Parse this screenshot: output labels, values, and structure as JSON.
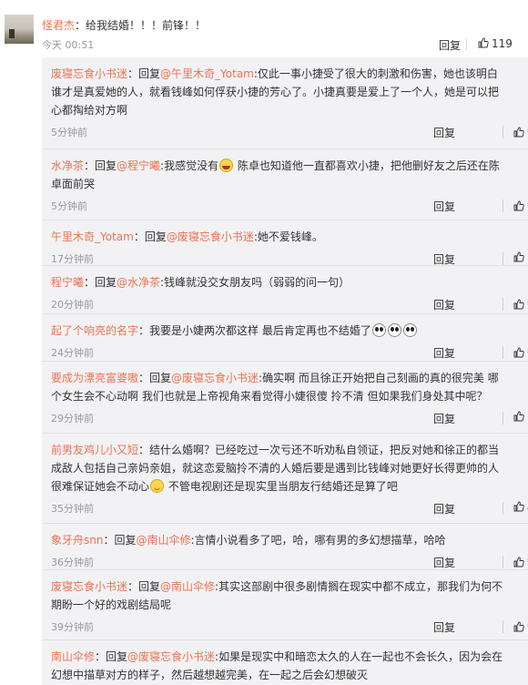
{
  "main_comment": {
    "user": "怪君杰",
    "text": "：给我结婚！！！前锋！！",
    "time": "今天 00:51",
    "reply_label": "回复",
    "likes": "119"
  },
  "replies": [
    {
      "parts": [
        {
          "t": "u",
          "v": "废寝忘食小书迷"
        },
        {
          "t": "n",
          "v": "：回复"
        },
        {
          "t": "m",
          "v": "@午里木奇_Yotam"
        },
        {
          "t": "n",
          "v": ":仅此一事小捷受了很大的刺激和伤害，她也该明白谁才是真爱她的人，就看钱峰如何俘获小捷的芳心了。小捷真要是爱上了一个人，她是可以把心都掏给对方啊"
        }
      ],
      "time": "5分钟前",
      "reply_label": "回复",
      "like": "赞"
    },
    {
      "parts": [
        {
          "t": "u",
          "v": "水净茶"
        },
        {
          "t": "n",
          "v": "：回复"
        },
        {
          "t": "m",
          "v": "@程宁曦"
        },
        {
          "t": "n",
          "v": ":我感觉没有"
        },
        {
          "t": "e",
          "v": "laugh"
        },
        {
          "t": "n",
          "v": " 陈卓也知道他一直都喜欢小捷，把他删好友之后还在陈卓面前哭"
        }
      ],
      "time": "5分钟前",
      "reply_label": "回复",
      "like": "赞"
    },
    {
      "parts": [
        {
          "t": "u",
          "v": "午里木奇_Yotam"
        },
        {
          "t": "n",
          "v": "：回复"
        },
        {
          "t": "m",
          "v": "@废寝忘食小书迷"
        },
        {
          "t": "n",
          "v": ":她不爱钱峰。"
        }
      ],
      "time": "17分钟前",
      "reply_label": "回复",
      "like": "1"
    },
    {
      "parts": [
        {
          "t": "u",
          "v": "程宁曦"
        },
        {
          "t": "n",
          "v": "：回复"
        },
        {
          "t": "m",
          "v": "@水净茶"
        },
        {
          "t": "n",
          "v": ":钱峰就没交女朋友吗（弱弱的问一句）"
        }
      ],
      "time": "20分钟前",
      "reply_label": "回复",
      "like": "赞"
    },
    {
      "parts": [
        {
          "t": "u",
          "v": "起了个响亮的名字"
        },
        {
          "t": "n",
          "v": "：我要是小婕两次都这样 最后肯定再也不结婚了"
        },
        {
          "t": "e",
          "v": "cry"
        },
        {
          "t": "e",
          "v": "cry"
        },
        {
          "t": "e",
          "v": "cry"
        }
      ],
      "time": "24分钟前",
      "reply_label": "回复",
      "like": "赞"
    },
    {
      "parts": [
        {
          "t": "u",
          "v": "要成为漂亮富婆嗷"
        },
        {
          "t": "n",
          "v": "：回复"
        },
        {
          "t": "m",
          "v": "@废寝忘食小书迷"
        },
        {
          "t": "n",
          "v": ":确实啊 而且徐正开始把自己刻画的真的很完美 哪个女生会不心动啊 我们也就是上帝视角来看觉得小婕很傻 拎不清 但如果我们身处其中呢？"
        }
      ],
      "time": "29分钟前",
      "reply_label": "回复",
      "like": "5"
    },
    {
      "parts": [
        {
          "t": "u",
          "v": "前男友鸡儿小又短"
        },
        {
          "t": "n",
          "v": "：结什么婚啊？已经吃过一次亏还不听劝私自领证，把反对她和徐正的都当成敌人包括自己亲妈亲姐，就这恋爱脑拎不清的人婚后要是遇到比钱峰对她更好长得更帅的人很难保证她会不动心"
        },
        {
          "t": "e",
          "v": "smile"
        },
        {
          "t": "n",
          "v": " 不管电视剧还是现实里当朋友行结婚还是算了吧"
        }
      ],
      "time": "35分钟前",
      "reply_label": "回复",
      "like": "4"
    },
    {
      "parts": [
        {
          "t": "u",
          "v": "象牙舟snn"
        },
        {
          "t": "n",
          "v": "：回复"
        },
        {
          "t": "m",
          "v": "@南山伞修"
        },
        {
          "t": "n",
          "v": ":言情小说看多了吧，哈，哪有男的多幻想描草，哈哈"
        }
      ],
      "time": "36分钟前",
      "reply_label": "回复",
      "like": "赞"
    },
    {
      "parts": [
        {
          "t": "u",
          "v": "废寝忘食小书迷"
        },
        {
          "t": "n",
          "v": "：回复"
        },
        {
          "t": "m",
          "v": "@南山伞修"
        },
        {
          "t": "n",
          "v": ":其实这部剧中很多剧情搁在现实中都不成立，那我们为何不期盼一个好的戏剧结局呢"
        }
      ],
      "time": "39分钟前",
      "reply_label": "回复",
      "like": "赞"
    },
    {
      "parts": [
        {
          "t": "u",
          "v": "南山伞修"
        },
        {
          "t": "n",
          "v": "：回复"
        },
        {
          "t": "m",
          "v": "@废寝忘食小书迷"
        },
        {
          "t": "n",
          "v": ":如果是现实中和暗恋太久的人在一起也不会长久，因为会在幻想中描草对方的样子，然后越想越完美，在一起之后会幻想破灭"
        }
      ],
      "time": "",
      "reply_label": "",
      "like": ""
    }
  ]
}
